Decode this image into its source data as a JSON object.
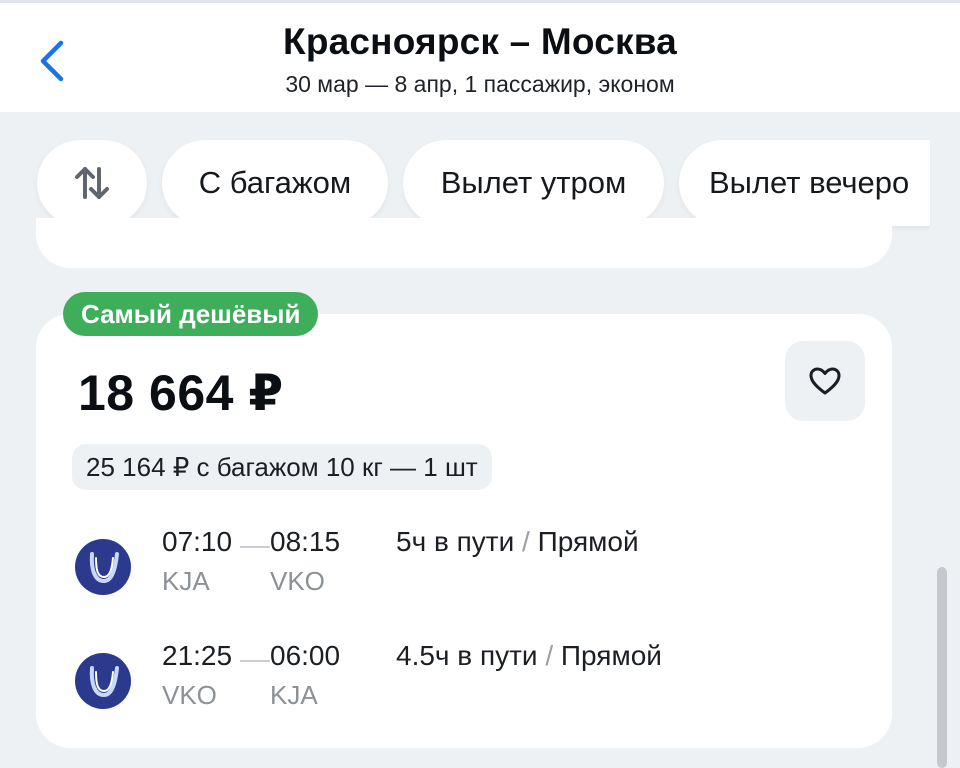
{
  "header": {
    "title": "Красноярск – Москва",
    "subtitle": "30 мар — 8 апр, 1 пассажир, эконом",
    "back_icon": "chevron-left-icon"
  },
  "filters": {
    "sort_icon": "sort-arrows-icon",
    "chips": [
      "С багажом",
      "Вылет утром",
      "Вылет вечеро"
    ]
  },
  "offer": {
    "badge": "Самый дешёвый",
    "price": "18 664 ₽",
    "baggage_price": "25 164 ₽ с багажом 10 кг — 1 шт",
    "favorite_icon": "heart-icon",
    "segments": [
      {
        "departure_time": "07:10",
        "arrival_time": "08:15",
        "departure_code": "KJA",
        "arrival_code": "VKO",
        "duration": "5ч в пути",
        "separator": "/",
        "type": "Прямой",
        "airline_icon": "airline-logo-icon"
      },
      {
        "departure_time": "21:25",
        "arrival_time": "06:00",
        "departure_code": "VKO",
        "arrival_code": "KJA",
        "duration": "4.5ч в пути",
        "separator": "/",
        "type": "Прямой",
        "airline_icon": "airline-logo-icon"
      }
    ]
  },
  "colors": {
    "accent": "#1a73e8",
    "badge": "#3fae5b",
    "background": "#eef1f4",
    "airline_logo": "#2b3a8c"
  }
}
